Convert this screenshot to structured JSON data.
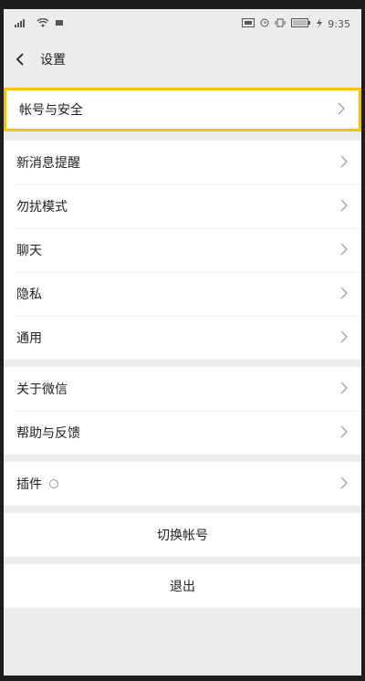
{
  "status_bar": {
    "time": "9:35",
    "battery_label": "100"
  },
  "nav": {
    "title": "设置"
  },
  "groups": [
    [
      {
        "label": "帐号与安全"
      }
    ],
    [
      {
        "label": "新消息提醒"
      },
      {
        "label": "勿扰模式"
      },
      {
        "label": "聊天"
      },
      {
        "label": "隐私"
      },
      {
        "label": "通用"
      }
    ],
    [
      {
        "label": "关于微信"
      },
      {
        "label": "帮助与反馈"
      }
    ],
    [
      {
        "label": "插件"
      }
    ]
  ],
  "actions": {
    "switch_account": "切换帐号",
    "logout": "退出"
  },
  "colors": {
    "highlight": "#f5c400",
    "background": "#ececec",
    "row": "#ffffff"
  }
}
